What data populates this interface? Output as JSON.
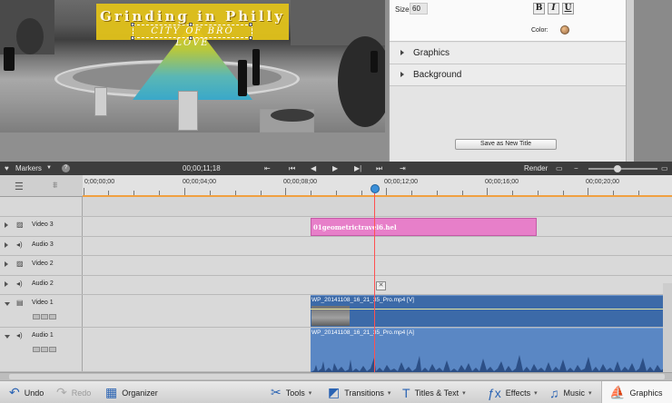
{
  "preview": {
    "title_main": "Grinding in Philly",
    "title_sub": "CITY OF BRO LOVE"
  },
  "properties": {
    "size_label": "Size",
    "size_value": "60",
    "bold_label": "B",
    "italic_label": "I",
    "underline_label": "U",
    "color_label": "Color:",
    "sections": [
      {
        "label": "Graphics"
      },
      {
        "label": "Background"
      }
    ],
    "save_button": "Save as New Title"
  },
  "timeline": {
    "markers_label": "Markers",
    "help_label": "?",
    "current_time": "00;00;11;18",
    "render_label": "Render",
    "ruler": [
      "0;00;00;00",
      "00;00;04;00",
      "00;00;08;00",
      "00;00;12;00",
      "00;00;16;00",
      "00;00;20;00"
    ],
    "tracks": [
      {
        "name": "Video 3"
      },
      {
        "name": "Audio 3"
      },
      {
        "name": "Video 2"
      },
      {
        "name": "Audio 2"
      },
      {
        "name": "Video 1"
      },
      {
        "name": "Audio 1"
      }
    ],
    "clips": {
      "title_clip": "01geometrictravel6.hel",
      "video_clip": "WP_20141108_16_21_35_Pro.mp4 [V]",
      "audio_clip": "WP_20141108_16_21_35_Pro.mp4 [A]"
    }
  },
  "actionbar": {
    "undo": "Undo",
    "redo": "Redo",
    "organizer": "Organizer",
    "tools": "Tools",
    "transitions": "Transitions",
    "titles_text": "Titles & Text",
    "effects": "Effects",
    "music": "Music",
    "graphics": "Graphics"
  },
  "colors": {
    "title_clip": "#e77fc9",
    "video_clip": "#3c6aa8",
    "audio_clip": "#5a87c4",
    "playhead": "#ff5050",
    "work_area": "#f0a040"
  }
}
